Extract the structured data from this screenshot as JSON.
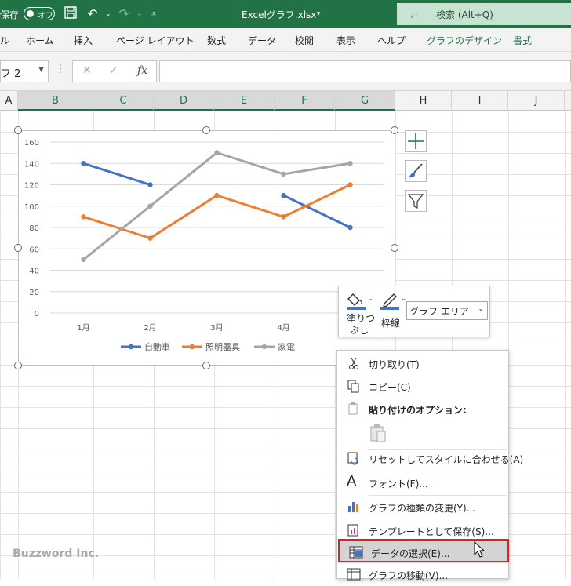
{
  "titlebar": {
    "autosave_label": "保存",
    "autosave_state": "オフ",
    "file_title": "Excelグラフ.xlsx",
    "search_placeholder": "検索 (Alt+Q)"
  },
  "ribbon": {
    "tabs": [
      {
        "label": "ル"
      },
      {
        "label": "ホーム"
      },
      {
        "label": "挿入"
      },
      {
        "label": "ページ レイアウト"
      },
      {
        "label": "数式"
      },
      {
        "label": "データ"
      },
      {
        "label": "校閲"
      },
      {
        "label": "表示"
      },
      {
        "label": "ヘルプ"
      },
      {
        "label": "グラフのデザイン"
      },
      {
        "label": "書式"
      }
    ]
  },
  "formula_bar": {
    "name_box": "フ 2",
    "formula_value": ""
  },
  "columns": [
    "A",
    "B",
    "C",
    "D",
    "E",
    "F",
    "G",
    "H",
    "I",
    "J"
  ],
  "chart_data": {
    "type": "line",
    "categories": [
      "1月",
      "2月",
      "3月",
      "4月"
    ],
    "ylim": [
      0,
      160
    ],
    "yticks": [
      "160",
      "140",
      "120",
      "100",
      "80",
      "60",
      "40",
      "20",
      "0"
    ],
    "series": [
      {
        "name": "自動車",
        "color": "#4472c4",
        "values": [
          140,
          120,
          null,
          110,
          80
        ]
      },
      {
        "name": "照明器具",
        "color": "#ed7d31",
        "values": [
          90,
          70,
          110,
          90,
          120
        ]
      },
      {
        "name": "家電",
        "color": "#a5a5a5",
        "values": [
          50,
          100,
          150,
          130,
          140
        ]
      }
    ]
  },
  "mini_toolbar": {
    "fill_label_1": "塗りつ",
    "fill_label_2": "ぶし",
    "outline_label": "枠線",
    "element_select": "グラフ エリア"
  },
  "context_menu": {
    "items": [
      {
        "label": "切り取り(T)"
      },
      {
        "label": "コピー(C)"
      },
      {
        "label": "貼り付けのオプション:"
      },
      {
        "label": "リセットしてスタイルに合わせる(A)"
      },
      {
        "label": "フォント(F)..."
      },
      {
        "label": "グラフの種類の変更(Y)..."
      },
      {
        "label": "テンプレートとして保存(S)..."
      },
      {
        "label": "データの選択(E)..."
      },
      {
        "label": "グラフの移動(V)..."
      }
    ]
  },
  "watermark": "Buzzword Inc."
}
